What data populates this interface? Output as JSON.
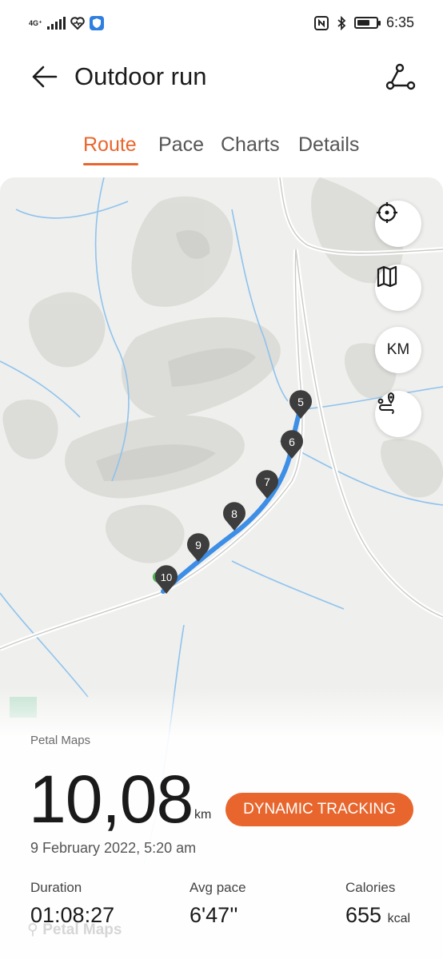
{
  "status_bar": {
    "network": "4G⁺",
    "time": "6:35",
    "battery_level": 0.7,
    "icons": [
      "signal-icon",
      "heart-health-icon",
      "shield-app-icon",
      "nfc-icon",
      "bluetooth-icon",
      "battery-icon"
    ]
  },
  "header": {
    "title": "Outdoor run",
    "back_icon": "back-arrow-icon",
    "action_icon": "route-share-icon"
  },
  "tabs": [
    {
      "label": "Route",
      "active": true
    },
    {
      "label": "Pace",
      "active": false
    },
    {
      "label": "Charts",
      "active": false
    },
    {
      "label": "Details",
      "active": false
    }
  ],
  "map": {
    "controls": [
      {
        "name": "locate-icon"
      },
      {
        "name": "map-layers-icon"
      },
      {
        "label": "KM"
      },
      {
        "name": "route-pin-icon"
      }
    ],
    "markers": [
      "5",
      "6",
      "7",
      "8",
      "9",
      "10"
    ],
    "provider": "Petal Maps",
    "watermark": "Petal Maps",
    "route_color": "#3c8ee6"
  },
  "summary": {
    "distance": "10,08",
    "distance_unit": "km",
    "tracking_button": "DYNAMIC TRACKING",
    "date": "9 February 2022, 5:20 am",
    "stats": [
      {
        "label": "Duration",
        "value": "01:08:27",
        "unit": ""
      },
      {
        "label": "Avg pace",
        "value": "6'47''",
        "unit": ""
      },
      {
        "label": "Calories",
        "value": "655",
        "unit": "kcal"
      }
    ]
  },
  "colors": {
    "accent": "#e8662d"
  }
}
